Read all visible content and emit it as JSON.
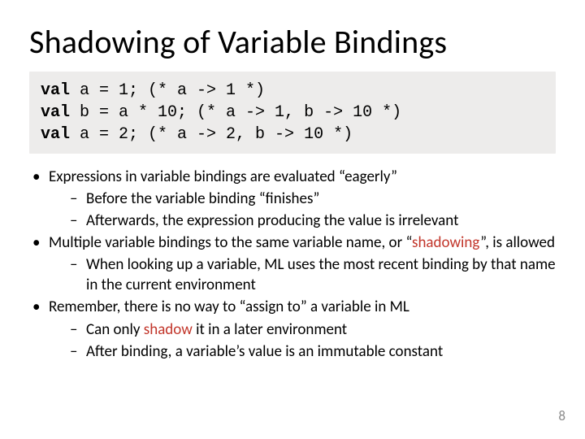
{
  "title": "Shadowing of Variable Bindings",
  "code": {
    "l1a": "val",
    "l1b": " a = 1; (* a -> 1 *)",
    "l2a": "val",
    "l2b": " b = a * 10; (* a -> 1, b -> 10 *)",
    "l3a": "val",
    "l3b": " a = 2; (* a -> 2, b -> 10 *)"
  },
  "bullets": {
    "b1": "Expressions in variable bindings are evaluated “eagerly”",
    "b1a": "Before the variable binding “finishes”",
    "b1b": "Afterwards, the expression producing the value is irrelevant",
    "b2_pre": "Multiple variable bindings to the same variable name, or “",
    "b2_hl": "shadowing",
    "b2_post": "”, is allowed",
    "b2a": "When looking up a variable, ML uses the most recent binding by that name in the current environment",
    "b3": "Remember, there is no way to “assign to” a variable in ML",
    "b3a_pre": "Can only ",
    "b3a_hl": "shadow",
    "b3a_post": " it in a later environment",
    "b3b": "After binding, a variable’s value is an immutable constant"
  },
  "page_number": "8"
}
